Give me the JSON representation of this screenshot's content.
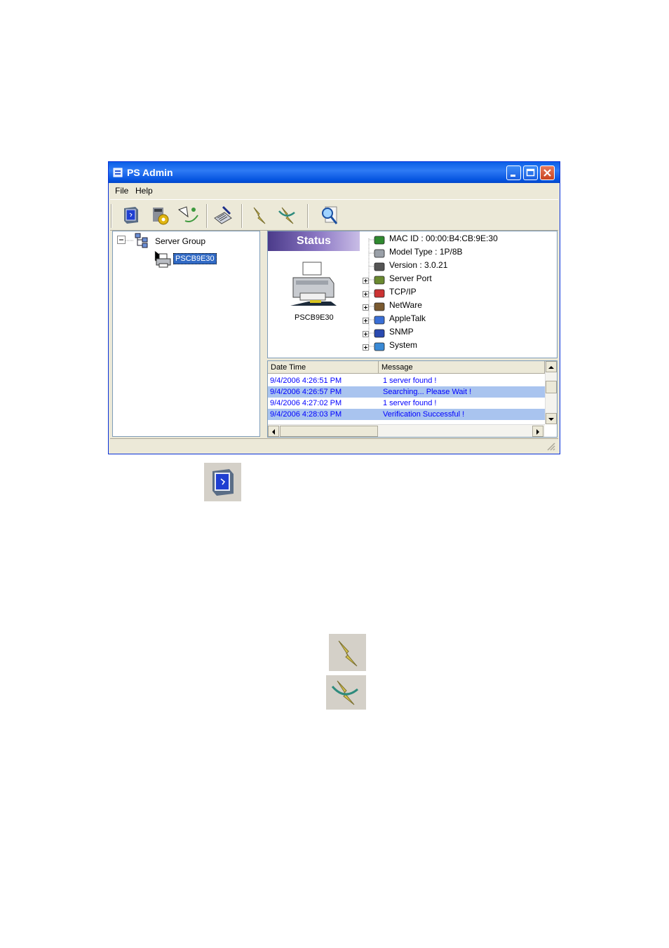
{
  "window": {
    "title": "PS Admin",
    "menu": [
      "File",
      "Help"
    ]
  },
  "toolbar": {
    "buttons": [
      {
        "name": "monitor-icon"
      },
      {
        "name": "settings-icon"
      },
      {
        "name": "search-network-icon"
      },
      {
        "name": "edit-icon"
      },
      {
        "name": "flash-icon"
      },
      {
        "name": "flash-off-icon"
      },
      {
        "name": "magnifier-icon"
      }
    ]
  },
  "tree": {
    "root": "Server Group",
    "selected": "PSCB9E30"
  },
  "status": {
    "banner": "Status",
    "printer_label": "PSCB9E30",
    "info": [
      {
        "text": "MAC ID : 00:00:B4:CB:9E:30",
        "icon": "network-card-icon",
        "expandable": false
      },
      {
        "text": "Model Type : 1P/8B",
        "icon": "device-icon",
        "expandable": false
      },
      {
        "text": "Version : 3.0.21",
        "icon": "version-icon",
        "expandable": false
      },
      {
        "text": "Server Port",
        "icon": "port-icon",
        "expandable": true
      },
      {
        "text": "TCP/IP",
        "icon": "tcpip-icon",
        "expandable": true
      },
      {
        "text": "NetWare",
        "icon": "netware-icon",
        "expandable": true
      },
      {
        "text": "AppleTalk",
        "icon": "apple-icon",
        "expandable": true
      },
      {
        "text": "SNMP",
        "icon": "snmp-icon",
        "expandable": true
      },
      {
        "text": "System",
        "icon": "system-icon",
        "expandable": true
      }
    ]
  },
  "log": {
    "columns": [
      "Date Time",
      "Message"
    ],
    "rows": [
      {
        "time": "9/4/2006 4:26:51 PM",
        "message": "1 server found !",
        "highlight": false
      },
      {
        "time": "9/4/2006 4:26:57 PM",
        "message": "Searching... Please Wait !",
        "highlight": true
      },
      {
        "time": "9/4/2006 4:27:02 PM",
        "message": "1 server found !",
        "highlight": false
      },
      {
        "time": "9/4/2006 4:28:03 PM",
        "message": "Verification Successful !",
        "highlight": true
      }
    ]
  },
  "doc_icons": [
    "monitor-icon",
    "flash-icon",
    "flash-off-icon"
  ]
}
